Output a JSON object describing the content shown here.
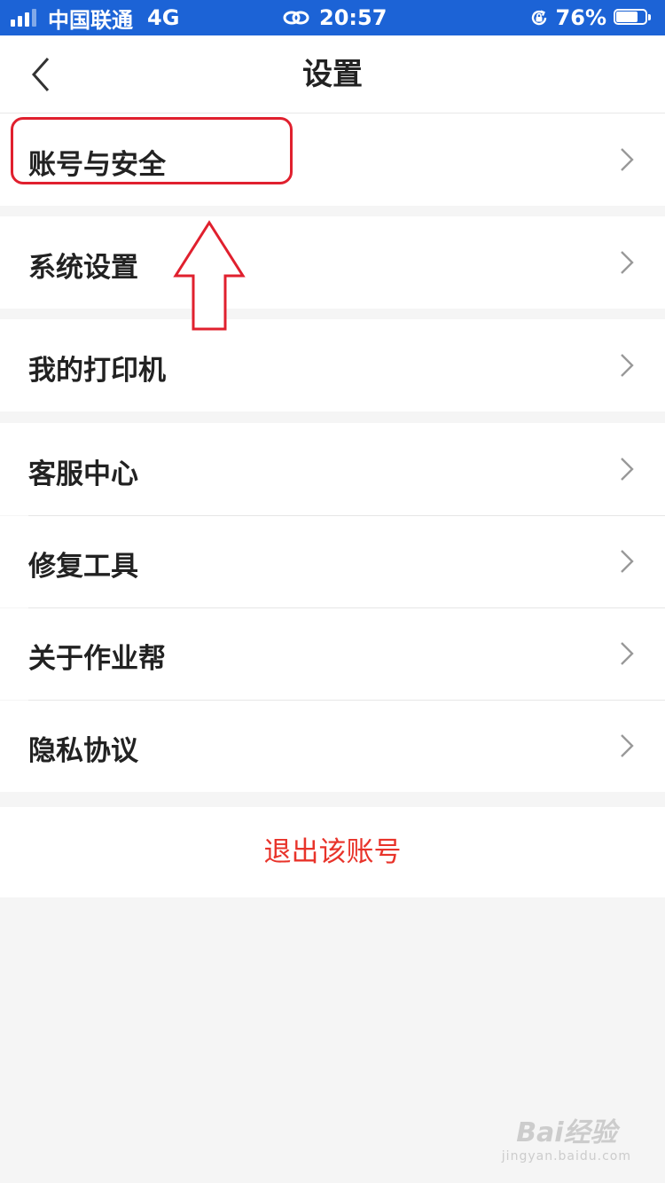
{
  "status_bar": {
    "carrier": "中国联通",
    "network": "4G",
    "time": "20:57",
    "battery_percent": "76%",
    "battery_level": 0.76,
    "icons": [
      "signal-icon",
      "link-icon",
      "orientation-lock-icon",
      "battery-icon"
    ]
  },
  "nav": {
    "title": "设置",
    "back_icon": "chevron-left-icon"
  },
  "menu": {
    "account_security": "账号与安全",
    "system_settings": "系统设置",
    "my_printer": "我的打印机",
    "customer_service": "客服中心",
    "repair_tools": "修复工具",
    "about": "关于作业帮",
    "privacy": "隐私协议",
    "row_icon": "chevron-right-icon"
  },
  "logout": {
    "label": "退出该账号"
  },
  "watermark": {
    "brand": "Bai经验",
    "url": "jingyan.baidu.com"
  },
  "colors": {
    "status_bar_bg": "#1c63d6",
    "logout_text": "#e8332a",
    "annotation_red": "#e0202e",
    "page_bg": "#f5f5f5"
  }
}
